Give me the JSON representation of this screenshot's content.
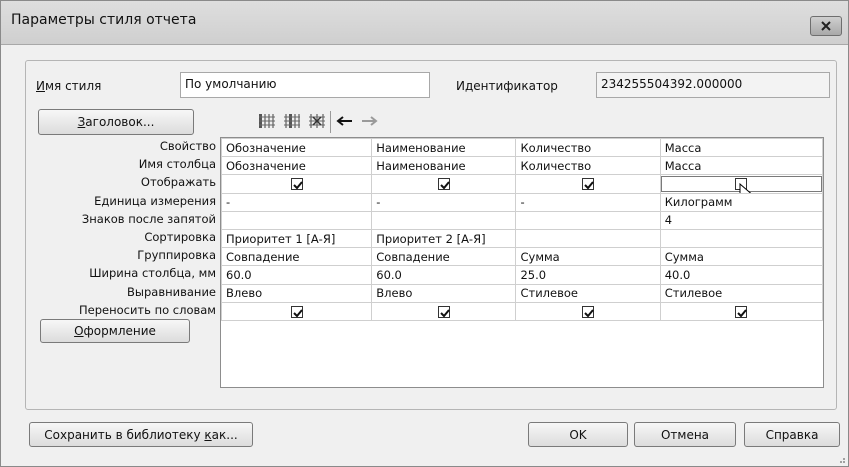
{
  "window": {
    "title": "Параметры стиля отчета"
  },
  "form": {
    "style_name_label": "Имя стиля",
    "style_name_value": "По умолчанию",
    "id_label": "Идентификатор",
    "id_value": "234255504392.000000"
  },
  "toolbar": {
    "header_button": "Заголовок...",
    "icons": [
      "insert-column-icon",
      "insert-column-right-icon",
      "delete-column-icon",
      "move-left-icon",
      "move-right-icon"
    ]
  },
  "grid": {
    "row_labels": [
      "Свойство",
      "Имя столбца",
      "Отображать",
      "Единица измерения",
      "Знаков после запятой",
      "Сортировка",
      "Группировка",
      "Ширина столбца, мм",
      "Выравнивание",
      "Переносить по словам"
    ],
    "columns": [
      {
        "property": "Обозначение",
        "column_name": "Обозначение",
        "show": true,
        "unit": "-",
        "decimals": "",
        "sort": "Приоритет 1 [А-Я]",
        "group": "Совпадение",
        "width": "60.0",
        "align": "Влево",
        "wrap": true
      },
      {
        "property": "Наименование",
        "column_name": "Наименование",
        "show": true,
        "unit": "-",
        "decimals": "",
        "sort": "Приоритет 2 [А-Я]",
        "group": "Совпадение",
        "width": "60.0",
        "align": "Влево",
        "wrap": true
      },
      {
        "property": "Количество",
        "column_name": "Количество",
        "show": true,
        "unit": "-",
        "decimals": "",
        "sort": "",
        "group": "Сумма",
        "width": "25.0",
        "align": "Стилевое",
        "wrap": true
      },
      {
        "property": "Масса",
        "column_name": "Масса",
        "show": false,
        "unit": "Килограмм",
        "decimals": "4",
        "sort": "",
        "group": "Сумма",
        "width": "40.0",
        "align": "Стилевое",
        "wrap": true
      }
    ]
  },
  "buttons": {
    "formatting": "Оформление",
    "save_to_library": "Сохранить в библиотеку как...",
    "ok": "OK",
    "cancel": "Отмена",
    "help": "Справка"
  }
}
